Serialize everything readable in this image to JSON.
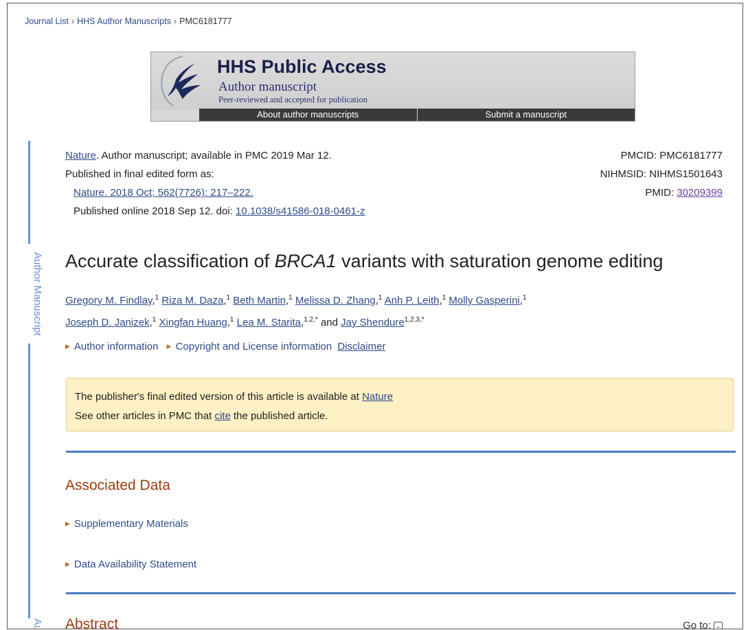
{
  "breadcrumb": [
    "Journal List",
    "HHS Author Manuscripts",
    "PMC6181777"
  ],
  "banner": {
    "title": "HHS Public Access",
    "subtitle": "Author manuscript",
    "peer": "Peer-reviewed and accepted for publication",
    "about": "About author manuscripts",
    "submit": "Submit a manuscript"
  },
  "side_tab": {
    "label": "Author Manuscript",
    "label_partial": "Autho"
  },
  "citation": {
    "journal": "Nature",
    "availability": ". Author manuscript; available in PMC 2019 Mar 12.",
    "published_as": "Published in final edited form as:",
    "ref": "Nature. 2018 Oct; 562(7726): 217–222.",
    "online": "Published online 2018 Sep 12. doi: ",
    "doi": "10.1038/s41586-018-0461-z",
    "pmcid": "PMCID: PMC6181777",
    "nihmsid": "NIHMSID: NIHMS1501643",
    "pmid_label": "PMID: ",
    "pmid": "30209399"
  },
  "article": {
    "title_before": "Accurate classification of ",
    "title_gene": "BRCA1",
    "title_after": " variants with saturation genome editing"
  },
  "authors": [
    {
      "name": "Gregory M. Findlay",
      "sup": "1"
    },
    {
      "name": "Riza M. Daza",
      "sup": "1"
    },
    {
      "name": "Beth Martin",
      "sup": "1"
    },
    {
      "name": "Melissa D. Zhang",
      "sup": "1"
    },
    {
      "name": "Anh P. Leith",
      "sup": "1"
    },
    {
      "name": "Molly Gasperini",
      "sup": "1"
    },
    {
      "name": "Joseph D. Janizek",
      "sup": "1"
    },
    {
      "name": "Xingfan Huang",
      "sup": "1"
    },
    {
      "name": "Lea M. Starita",
      "sup": "1,2,*"
    },
    {
      "name": "Jay Shendure",
      "sup": "1,2,3,*"
    }
  ],
  "authors_and": "and",
  "info_links": {
    "author_info": "Author information",
    "copyright": "Copyright and License information",
    "disclaimer": "Disclaimer"
  },
  "notice": {
    "line1_text": "The publisher's final edited version of this article is available at ",
    "line1_link": "Nature",
    "line2_before": "See other articles in PMC that ",
    "line2_link": "cite",
    "line2_after": " the published article."
  },
  "associated": {
    "heading": "Associated Data",
    "supplementary": "Supplementary Materials",
    "data_availability": "Data Availability Statement"
  },
  "abstract": {
    "heading": "Abstract",
    "goto": "Go to:",
    "goto_icon": "chevron-down-icon"
  },
  "colors": {
    "link": "#2f4a8a",
    "heading": "#9b3c12",
    "rule": "#4a7bc0",
    "notice_bg": "#fdf0c4",
    "side_tab": "#6b8fd6"
  }
}
